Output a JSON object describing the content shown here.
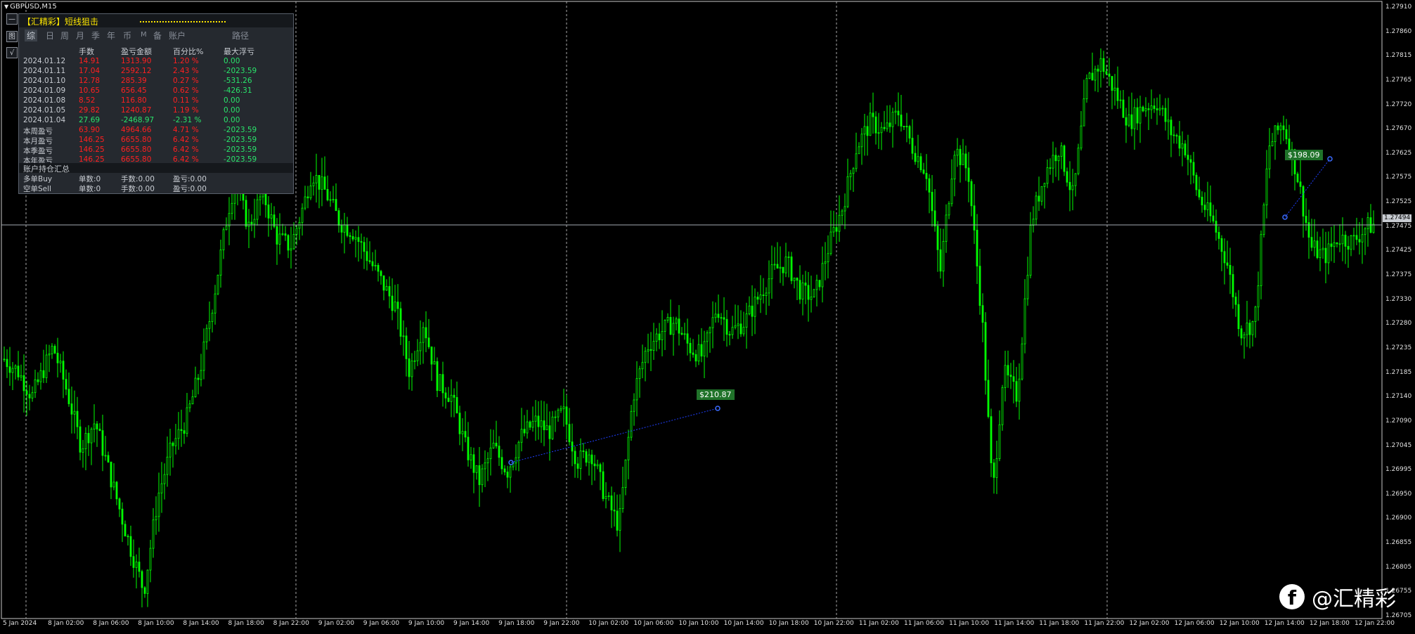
{
  "symbol": {
    "title": "GBPUSD,M15"
  },
  "side_buttons": [
    "—",
    "图",
    "√"
  ],
  "panel": {
    "title": "【汇精彩】短线狙击",
    "tabs": [
      "综",
      "日",
      "周",
      "月",
      "季",
      "年",
      "币",
      "M",
      "备",
      "账户",
      "路径"
    ],
    "headers": {
      "lots": "手数",
      "pnl": "盈亏金额",
      "pct": "百分比%",
      "dd": "最大浮亏"
    },
    "rows": [
      {
        "date": "2024.01.12",
        "lots": "14.91",
        "pnl": "1313.90",
        "pct": "1.20 %",
        "dd": "0.00",
        "color": "red"
      },
      {
        "date": "2024.01.11",
        "lots": "17.04",
        "pnl": "2592.12",
        "pct": "2.43 %",
        "dd": "-2023.59",
        "color": "red"
      },
      {
        "date": "2024.01.10",
        "lots": "12.78",
        "pnl": "285.39",
        "pct": "0.27 %",
        "dd": "-531.26",
        "color": "red"
      },
      {
        "date": "2024.01.09",
        "lots": "10.65",
        "pnl": "656.45",
        "pct": "0.62 %",
        "dd": "-426.31",
        "color": "red"
      },
      {
        "date": "2024.01.08",
        "lots": "8.52",
        "pnl": "116.80",
        "pct": "0.11 %",
        "dd": "0.00",
        "color": "red"
      },
      {
        "date": "2024.01.05",
        "lots": "29.82",
        "pnl": "1240.87",
        "pct": "1.19 %",
        "dd": "0.00",
        "color": "red"
      },
      {
        "date": "2024.01.04",
        "lots": "27.69",
        "pnl": "-2468.97",
        "pct": "-2.31 %",
        "dd": "0.00",
        "color": "green"
      },
      {
        "date": "本周盈亏",
        "lots": "63.90",
        "pnl": "4964.66",
        "pct": "4.71 %",
        "dd": "-2023.59",
        "color": "red"
      },
      {
        "date": "本月盈亏",
        "lots": "146.25",
        "pnl": "6655.80",
        "pct": "6.42 %",
        "dd": "-2023.59",
        "color": "red"
      },
      {
        "date": "本季盈亏",
        "lots": "146.25",
        "pnl": "6655.80",
        "pct": "6.42 %",
        "dd": "-2023.59",
        "color": "red"
      },
      {
        "date": "本年盈亏",
        "lots": "146.25",
        "pnl": "6655.80",
        "pct": "6.42 %",
        "dd": "-2023.59",
        "color": "red"
      }
    ],
    "positions_title": "账户持仓汇总",
    "positions": [
      {
        "side": "多单Buy",
        "count": "单数:0",
        "lots": "手数:0.00",
        "pnl": "盈亏:0.00"
      },
      {
        "side": "空单Sell",
        "count": "单数:0",
        "lots": "手数:0.00",
        "pnl": "盈亏:0.00"
      }
    ]
  },
  "chart_data": {
    "type": "candlestick",
    "symbol": "GBPUSD",
    "timeframe": "M15",
    "price_ticks": [
      "1.27910",
      "1.27860",
      "1.27815",
      "1.27765",
      "1.27720",
      "1.27670",
      "1.27625",
      "1.27575",
      "1.27525",
      "1.27475",
      "1.27425",
      "1.27375",
      "1.27330",
      "1.27280",
      "1.27235",
      "1.27185",
      "1.27140",
      "1.27090",
      "1.27045",
      "1.26995",
      "1.26950",
      "1.26900",
      "1.26855",
      "1.26805",
      "1.26755",
      "1.26705"
    ],
    "price_range": [
      1.26705,
      1.27925
    ],
    "current_price": "1.27494",
    "time_labels": [
      "5 Jan 2024",
      "8 Jan 02:00",
      "8 Jan 06:00",
      "8 Jan 10:00",
      "8 Jan 14:00",
      "8 Jan 18:00",
      "8 Jan 22:00",
      "9 Jan 02:00",
      "9 Jan 06:00",
      "9 Jan 10:00",
      "9 Jan 14:00",
      "9 Jan 18:00",
      "9 Jan 22:00",
      "10 Jan 02:00",
      "10 Jan 06:00",
      "10 Jan 10:00",
      "10 Jan 14:00",
      "10 Jan 18:00",
      "10 Jan 22:00",
      "11 Jan 02:00",
      "11 Jan 06:00",
      "11 Jan 10:00",
      "11 Jan 14:00",
      "11 Jan 18:00",
      "11 Jan 22:00",
      "12 Jan 02:00",
      "12 Jan 06:00",
      "12 Jan 10:00",
      "12 Jan 14:00",
      "12 Jan 18:00",
      "12 Jan 22:00"
    ],
    "price_path": [
      [
        0,
        1.27225
      ],
      [
        4,
        1.272
      ],
      [
        8,
        1.2715
      ],
      [
        14,
        1.2725
      ],
      [
        18,
        1.2716
      ],
      [
        22,
        1.2705
      ],
      [
        26,
        1.271
      ],
      [
        30,
        1.27
      ],
      [
        36,
        1.2685
      ],
      [
        40,
        1.2676
      ],
      [
        44,
        1.2695
      ],
      [
        48,
        1.2705
      ],
      [
        52,
        1.271
      ],
      [
        56,
        1.272
      ],
      [
        60,
        1.2735
      ],
      [
        64,
        1.2752
      ],
      [
        66,
        1.2758
      ],
      [
        70,
        1.2749
      ],
      [
        74,
        1.2756
      ],
      [
        78,
        1.2747
      ],
      [
        82,
        1.2745
      ],
      [
        86,
        1.2754
      ],
      [
        88,
        1.276
      ],
      [
        92,
        1.2756
      ],
      [
        96,
        1.275
      ],
      [
        100,
        1.2748
      ],
      [
        104,
        1.2743
      ],
      [
        108,
        1.2738
      ],
      [
        112,
        1.2733
      ],
      [
        116,
        1.272
      ],
      [
        120,
        1.273
      ],
      [
        124,
        1.2718
      ],
      [
        128,
        1.2715
      ],
      [
        132,
        1.2705
      ],
      [
        136,
        1.2698
      ],
      [
        140,
        1.2705
      ],
      [
        144,
        1.27
      ],
      [
        148,
        1.2707
      ],
      [
        152,
        1.271
      ],
      [
        156,
        1.2708
      ],
      [
        160,
        1.2712
      ],
      [
        164,
        1.2702
      ],
      [
        168,
        1.2704
      ],
      [
        172,
        1.2695
      ],
      [
        176,
        1.2689
      ],
      [
        180,
        1.2715
      ],
      [
        184,
        1.2725
      ],
      [
        188,
        1.2728
      ],
      [
        192,
        1.273
      ],
      [
        196,
        1.2725
      ],
      [
        200,
        1.2723
      ],
      [
        204,
        1.2733
      ],
      [
        208,
        1.2728
      ],
      [
        212,
        1.273
      ],
      [
        216,
        1.2735
      ],
      [
        220,
        1.274
      ],
      [
        224,
        1.2742
      ],
      [
        228,
        1.2736
      ],
      [
        232,
        1.2735
      ],
      [
        236,
        1.2745
      ],
      [
        240,
        1.2753
      ],
      [
        244,
        1.2765
      ],
      [
        248,
        1.277
      ],
      [
        252,
        1.2768
      ],
      [
        256,
        1.2772
      ],
      [
        260,
        1.2765
      ],
      [
        264,
        1.276
      ],
      [
        268,
        1.274
      ],
      [
        272,
        1.2765
      ],
      [
        276,
        1.276
      ],
      [
        280,
        1.273
      ],
      [
        283,
        1.2695
      ],
      [
        286,
        1.272
      ],
      [
        290,
        1.2715
      ],
      [
        294,
        1.275
      ],
      [
        298,
        1.276
      ],
      [
        302,
        1.2765
      ],
      [
        306,
        1.2755
      ],
      [
        310,
        1.2778
      ],
      [
        314,
        1.2782
      ],
      [
        318,
        1.2776
      ],
      [
        322,
        1.277
      ],
      [
        326,
        1.2773
      ],
      [
        330,
        1.2774
      ],
      [
        334,
        1.2768
      ],
      [
        338,
        1.2765
      ],
      [
        342,
        1.2755
      ],
      [
        346,
        1.275
      ],
      [
        350,
        1.2742
      ],
      [
        354,
        1.2728
      ],
      [
        358,
        1.273
      ],
      [
        362,
        1.2765
      ],
      [
        366,
        1.277
      ],
      [
        370,
        1.276
      ],
      [
        374,
        1.2745
      ],
      [
        378,
        1.2743
      ],
      [
        382,
        1.2747
      ],
      [
        386,
        1.2746
      ],
      [
        390,
        1.2749
      ],
      [
        392,
        1.27494
      ]
    ],
    "trades": [
      {
        "label": "$210.87"
      },
      {
        "label": "$198.09"
      }
    ]
  },
  "watermark": {
    "icon": "facebook-icon",
    "text": "@汇精彩"
  },
  "colors": {
    "candle": "#00ff00",
    "grid": "#a9a9a9",
    "bid_line": "#a5aab2",
    "trade_line": "#1f3fff",
    "trade_label_bg": "#20732a"
  }
}
